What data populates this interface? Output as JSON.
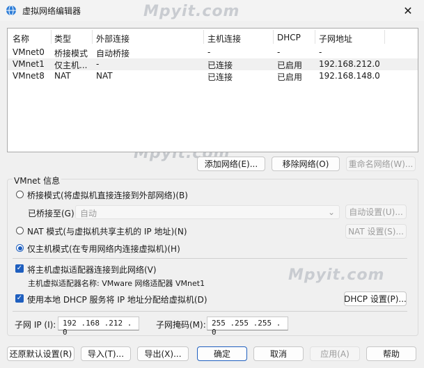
{
  "window": {
    "title": "虚拟网络编辑器",
    "close_glyph": "✕"
  },
  "watermarks": [
    "Mpyit.com",
    "Mpyit.com",
    "Mpyit.com"
  ],
  "table": {
    "headers": [
      "名称",
      "类型",
      "外部连接",
      "主机连接",
      "DHCP",
      "子网地址"
    ],
    "rows": [
      [
        "VMnet0",
        "桥接模式",
        "自动桥接",
        "-",
        "-",
        "-"
      ],
      [
        "VMnet1",
        "仅主机...",
        "-",
        "已连接",
        "已启用",
        "192.168.212.0"
      ],
      [
        "VMnet8",
        "NAT",
        "NAT",
        "已连接",
        "已启用",
        "192.168.148.0"
      ]
    ]
  },
  "table_buttons": {
    "add": "添加网络(E)...",
    "remove": "移除网络(O)",
    "rename": "重命名网络(W)..."
  },
  "vmnet_info": {
    "title": "VMnet 信息",
    "bridged_label": "桥接模式(将虚拟机直接连接到外部网络)(B)",
    "bridged_to_label": "已桥接至(G):",
    "bridged_to_value": "自动",
    "auto_settings": "自动设置(U)...",
    "nat_label": "NAT 模式(与虚拟机共享主机的 IP 地址)(N)",
    "nat_settings": "NAT 设置(S)...",
    "hostonly_label": "仅主机模式(在专用网络内连接虚拟机)(H)",
    "connect_adapter_label": "将主机虚拟适配器连接到此网络(V)",
    "adapter_name_label": "主机虚拟适配器名称: VMware 网络适配器 VMnet1",
    "use_dhcp_label": "使用本地 DHCP 服务将 IP 地址分配给虚拟机(D)",
    "dhcp_settings": "DHCP 设置(P)...",
    "subnet_ip_label": "子网 IP (I):",
    "subnet_ip_value": "192 .168 .212 . 0",
    "subnet_mask_label": "子网掩码(M):",
    "subnet_mask_value": "255 .255 .255 . 0",
    "selected_mode": "hostonly"
  },
  "footer": {
    "restore": "还原默认设置(R)",
    "import": "导入(T)...",
    "export": "导出(X)...",
    "ok": "确定",
    "cancel": "取消",
    "apply": "应用(A)",
    "help": "帮助"
  },
  "colors": {
    "accent": "#1f5fbf",
    "watermark": "#c9ccd1"
  }
}
